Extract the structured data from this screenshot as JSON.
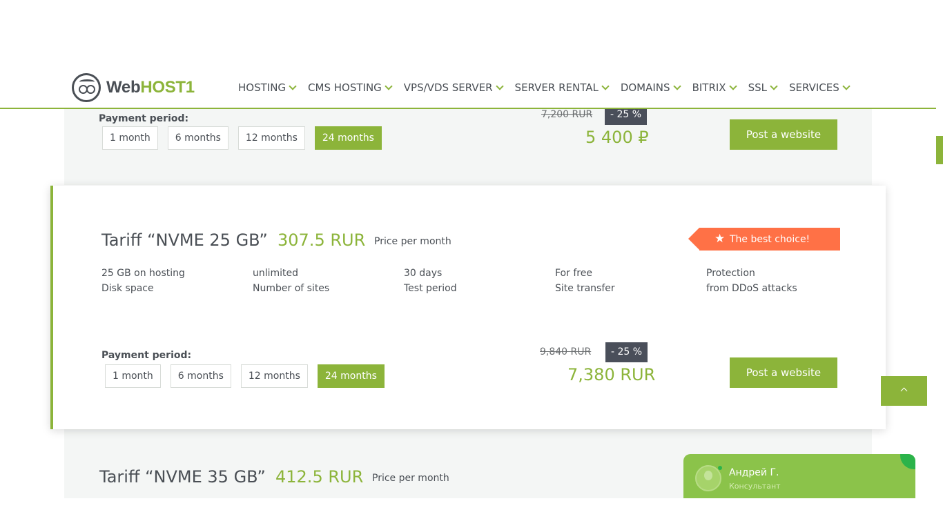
{
  "brand": {
    "name_plain": "Web",
    "name_accent": "HOST1"
  },
  "nav": [
    {
      "label": "HOSTING"
    },
    {
      "label": "CMS HOSTING"
    },
    {
      "label": "VPS/VDS SERVER"
    },
    {
      "label": "SERVER RENTAL"
    },
    {
      "label": "DOMAINS"
    },
    {
      "label": "BITRIX"
    },
    {
      "label": "SSL"
    },
    {
      "label": "SERVICES"
    }
  ],
  "prev_tariff": {
    "period_label": "Payment period:",
    "periods": [
      "1 month",
      "6 months",
      "12 months",
      "24 months"
    ],
    "active_period": "24 months",
    "old_price": "7,200 RUR",
    "discount": "- 25 %",
    "price": "5 400 ₽",
    "button": "Post a website"
  },
  "tariff": {
    "title": "Tariff “NVME 25 GB”",
    "price": "307.5 RUR",
    "price_note": "Price per month",
    "badge": "The best choice!",
    "features": [
      {
        "value": "25 GB on hosting",
        "label": "Disk space"
      },
      {
        "value": "unlimited",
        "label": "Number of sites"
      },
      {
        "value": "30 days",
        "label": "Test period"
      },
      {
        "value": "For free",
        "label": "Site transfer"
      },
      {
        "value": "Protection",
        "label": "from DDoS attacks"
      }
    ],
    "period_label": "Payment period:",
    "periods": [
      "1 month",
      "6 months",
      "12 months",
      "24 months"
    ],
    "active_period": "24 months",
    "old_price": "9,840 RUR",
    "discount": "- 25 %",
    "total": "7,380 RUR",
    "button": "Post a website"
  },
  "next_tariff": {
    "title": "Tariff “NVME 35 GB”",
    "price": "412.5 RUR",
    "price_note": "Price per month"
  },
  "chat": {
    "name": "Андрей Г.",
    "role": "Консультант"
  },
  "colors": {
    "accent": "#8cb43a",
    "badge": "#ff7146",
    "discount_bg": "#4a4f5a"
  }
}
